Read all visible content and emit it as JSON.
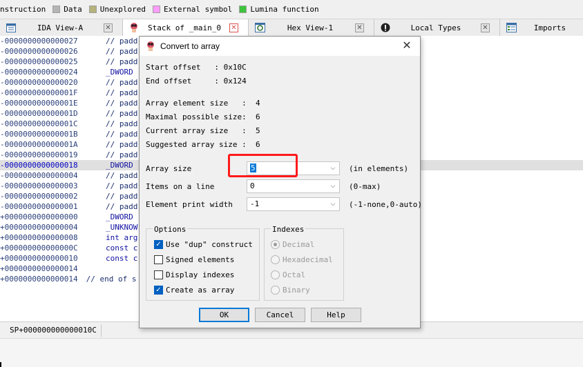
{
  "legend": [
    {
      "label": "nstruction",
      "color": ""
    },
    {
      "label": "Data",
      "color": "#b4b4b4"
    },
    {
      "label": "Unexplored",
      "color": "#b5b27c"
    },
    {
      "label": "External symbol",
      "color": "#ff9cff"
    },
    {
      "label": "Lumina function",
      "color": "#3dc43d"
    }
  ],
  "tabs": [
    {
      "label": "IDA View-A",
      "icon": "ida-view-icon"
    },
    {
      "label": "Stack of _main_0",
      "icon": "stack-frame-icon"
    },
    {
      "label": "Hex View-1",
      "icon": "hex-view-icon"
    },
    {
      "label": "Local Types",
      "icon": "local-types-icon"
    },
    {
      "label": "Imports",
      "icon": "imports-icon"
    }
  ],
  "close_glyph": "✕",
  "code_lines": [
    {
      "addr": "-0000000000000027",
      "text": "// padd"
    },
    {
      "addr": "-0000000000000026",
      "text": "// padd"
    },
    {
      "addr": "-0000000000000025",
      "text": "// padd"
    },
    {
      "addr": "-0000000000000024",
      "text": "_DWORD"
    },
    {
      "addr": "-0000000000000020",
      "text": "// padd"
    },
    {
      "addr": "-000000000000001F",
      "text": "// padd"
    },
    {
      "addr": "-000000000000001E",
      "text": "// padd"
    },
    {
      "addr": "-000000000000001D",
      "text": "// padd"
    },
    {
      "addr": "-000000000000001C",
      "text": "// padd"
    },
    {
      "addr": "-000000000000001B",
      "text": "// padd"
    },
    {
      "addr": "-000000000000001A",
      "text": "// padd"
    },
    {
      "addr": "-0000000000000019",
      "text": "// padd"
    },
    {
      "addr": "-0000000000000018",
      "text": "_DWORD"
    },
    {
      "addr": "-0000000000000004",
      "text": "// padd"
    },
    {
      "addr": "-0000000000000003",
      "text": "// padd"
    },
    {
      "addr": "-0000000000000002",
      "text": "// padd"
    },
    {
      "addr": "-0000000000000001",
      "text": "// padd"
    },
    {
      "addr": "+0000000000000000",
      "text": "_DWORD"
    },
    {
      "addr": "+0000000000000004",
      "text": "_UNKNOW"
    },
    {
      "addr": "+0000000000000008",
      "text": "int arg"
    },
    {
      "addr": "+000000000000000C",
      "text": "const c"
    },
    {
      "addr": "+0000000000000010",
      "text": "const c"
    },
    {
      "addr": "+0000000000000014",
      "text": ""
    },
    {
      "addr": "+0000000000000014",
      "text": " // end of s"
    }
  ],
  "status": {
    "sp": "SP+000000000000010C"
  },
  "dialog": {
    "title": "Convert to array",
    "start_offset": "Start offset   : 0x10C",
    "end_offset": "End offset     : 0x124",
    "elem_size": "Array element size   :  4",
    "max_size": "Maximal possible size:  6",
    "cur_size": "Current array size   :  5",
    "sugg_size": "Suggested array size :  6",
    "array_size_label": "Array size",
    "array_size_value": "5",
    "array_size_hint": "(in elements)",
    "items_label": "Items on a line",
    "items_value": "0",
    "items_hint": "(0-max)",
    "width_label": "Element print width",
    "width_value": "-1",
    "width_hint": "(-1-none,0-auto)",
    "options_title": "Options",
    "options": [
      {
        "label": "Use \"dup\" construct",
        "checked": true
      },
      {
        "label": "Signed elements",
        "checked": false
      },
      {
        "label": "Display indexes",
        "checked": false
      },
      {
        "label": "Create as array",
        "checked": true
      }
    ],
    "indexes_title": "Indexes",
    "indexes": [
      {
        "label": "Decimal",
        "selected": true
      },
      {
        "label": "Hexadecimal",
        "selected": false
      },
      {
        "label": "Octal",
        "selected": false
      },
      {
        "label": "Binary",
        "selected": false
      }
    ],
    "ok_label": "OK",
    "cancel_label": "Cancel",
    "help_label": "Help",
    "close_glyph": "✕",
    "dropdown_glyph": "⌵",
    "check_glyph": "✓"
  }
}
